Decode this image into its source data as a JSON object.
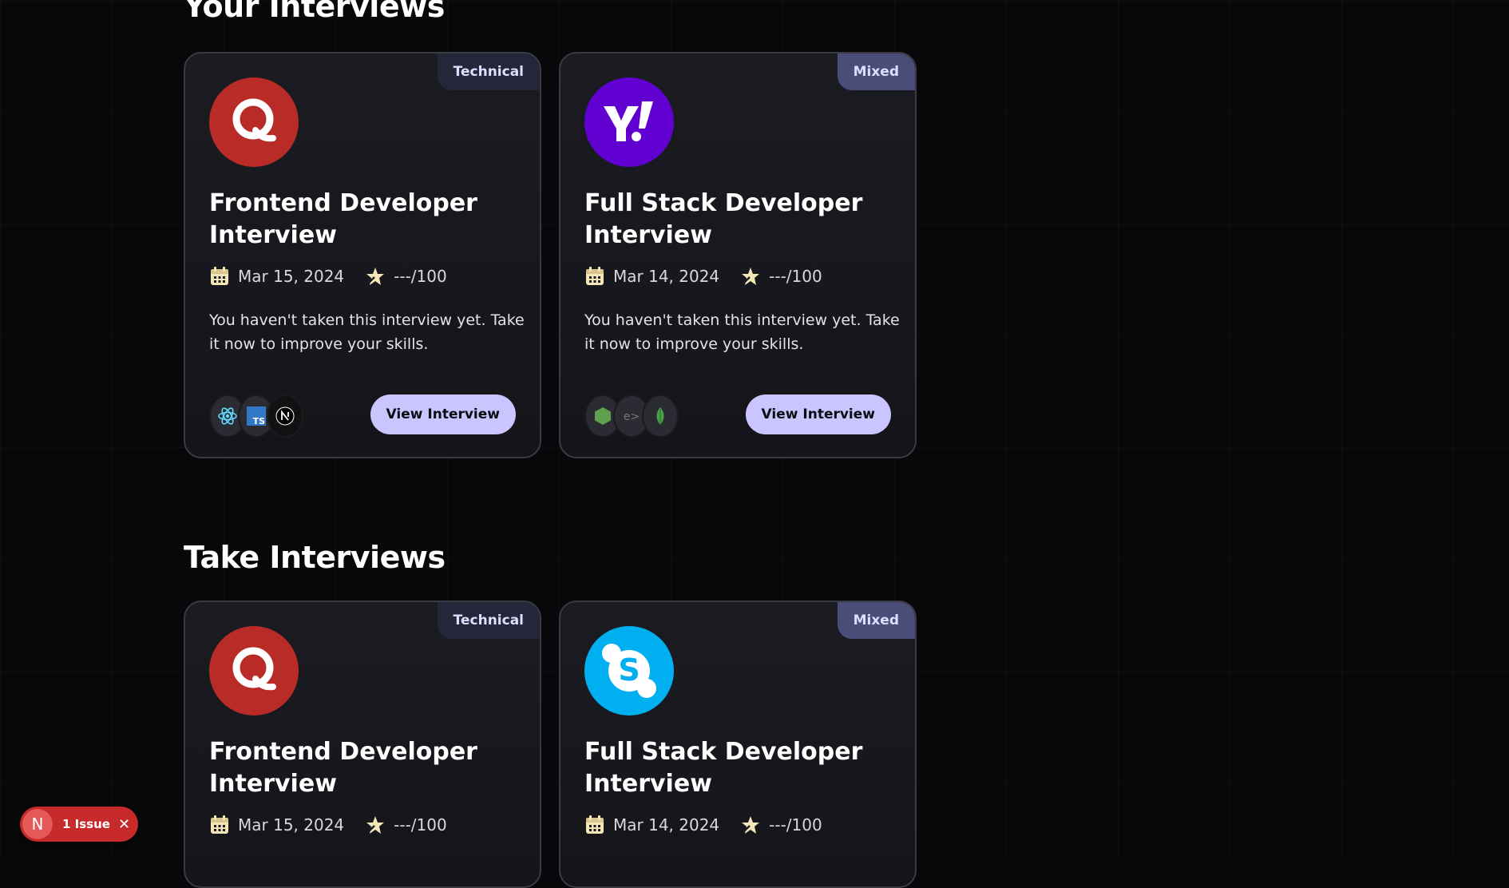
{
  "sections": [
    {
      "title": "Your Interviews",
      "cards": [
        {
          "badge": "Technical",
          "logo": "quora-logo",
          "title": "Frontend Developer Interview",
          "date": "Mar 15, 2024",
          "score": "---/100",
          "description": "You haven't taken this interview yet. Take it now to improve your skills.",
          "tech_icons": [
            "react-icon",
            "typescript-icon",
            "nextjs-icon"
          ],
          "button": "View Interview"
        },
        {
          "badge": "Mixed",
          "logo": "yahoo-logo",
          "title": "Full Stack Developer Interview",
          "date": "Mar 14, 2024",
          "score": "---/100",
          "description": "You haven't taken this interview yet. Take it now to improve your skills.",
          "tech_icons": [
            "nodejs-icon",
            "express-icon",
            "mongodb-icon"
          ],
          "button": "View Interview"
        }
      ]
    },
    {
      "title": "Take Interviews",
      "cards": [
        {
          "badge": "Technical",
          "logo": "quora-logo",
          "title": "Frontend Developer Interview",
          "date": "Mar 15, 2024",
          "score": "---/100"
        },
        {
          "badge": "Mixed",
          "logo": "skype-logo",
          "title": "Full Stack Developer Interview",
          "date": "Mar 14, 2024",
          "score": "---/100"
        }
      ]
    }
  ],
  "dev_indicator": {
    "letter": "N",
    "label": "1 Issue",
    "close_icon": "close-icon"
  },
  "colors": {
    "background": "#08080a",
    "card": "#1b1c22",
    "button": "#cac5fe",
    "badge_technical": "#24263a",
    "badge_mixed": "#4a4d78",
    "quora": "#b92b27",
    "yahoo": "#6001d2",
    "skype": "#00aff0",
    "icon_accent": "#f5e6b8",
    "issue": "#c62a2a"
  }
}
